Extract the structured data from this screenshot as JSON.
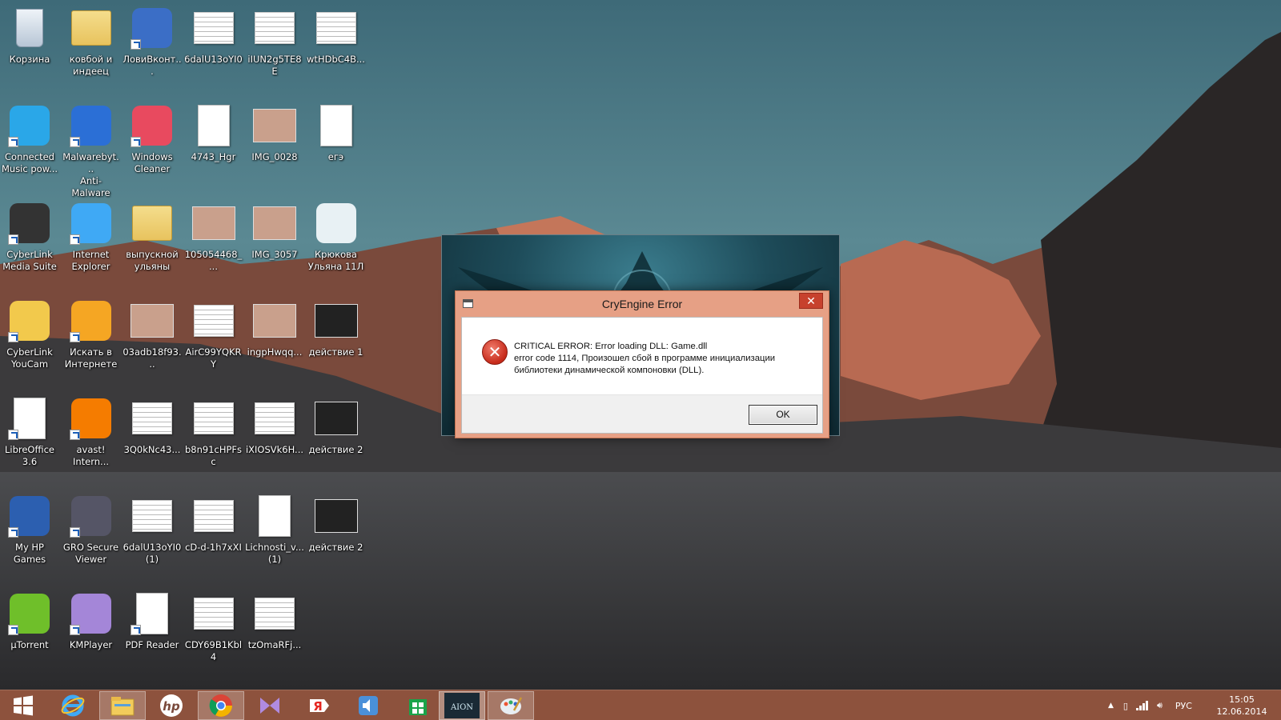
{
  "desktop": {
    "icons": [
      {
        "id": "recycle",
        "label": "Корзина",
        "icon": "recycle-bin-icon"
      },
      {
        "id": "folder1",
        "label": "ковбой и\nиндеец",
        "icon": "folder-icon"
      },
      {
        "id": "lovivk",
        "label": "ЛовиВконт...",
        "icon": "app-lb-icon"
      },
      {
        "id": "doc1",
        "label": "6dalU13oYI0",
        "icon": "document-icon"
      },
      {
        "id": "doc2",
        "label": "iIUN2g5TE8E",
        "icon": "document-icon"
      },
      {
        "id": "doc3",
        "label": "wtHDbC4B...",
        "icon": "document-icon"
      },
      {
        "id": "cmp",
        "label": "Connected\nMusic pow...",
        "icon": "equalizer-icon"
      },
      {
        "id": "mbam",
        "label": "Malwarebyt...\nAnti-Malware",
        "icon": "malwarebytes-icon"
      },
      {
        "id": "wcleaner",
        "label": "Windows\nCleaner",
        "icon": "windows-cleaner-icon"
      },
      {
        "id": "hgr",
        "label": "4743_Hgr",
        "icon": "text-document-icon"
      },
      {
        "id": "img28",
        "label": "IMG_0028",
        "icon": "photo-icon"
      },
      {
        "id": "ege",
        "label": "егэ",
        "icon": "word-document-icon"
      },
      {
        "id": "cyberms",
        "label": "CyberLink\nMedia Suite",
        "icon": "cyberlink-media-suite-icon"
      },
      {
        "id": "ie",
        "label": "Internet\nExplorer",
        "icon": "internet-explorer-icon"
      },
      {
        "id": "folder2",
        "label": "выпускной\nульяны",
        "icon": "folder-icon"
      },
      {
        "id": "img105",
        "label": "105054468_...",
        "icon": "photo-icon"
      },
      {
        "id": "img3057",
        "label": "IMG_3057",
        "icon": "photo-icon"
      },
      {
        "id": "pres",
        "label": "Крюкова\nУльяна 11Л",
        "icon": "presentation-icon"
      },
      {
        "id": "youcam",
        "label": "CyberLink\nYouCam",
        "icon": "youcam-icon"
      },
      {
        "id": "search",
        "label": "Искать в\nИнтернете",
        "icon": "search-web-icon"
      },
      {
        "id": "img03",
        "label": "03adb18f93...",
        "icon": "photo-icon"
      },
      {
        "id": "air",
        "label": "AirC99YQKRY",
        "icon": "document-icon"
      },
      {
        "id": "ingp",
        "label": "ingpHwqq...",
        "icon": "photo-icon"
      },
      {
        "id": "act1",
        "label": "действие 1",
        "icon": "video-icon"
      },
      {
        "id": "libre",
        "label": "LibreOffice\n3.6",
        "icon": "libreoffice-icon"
      },
      {
        "id": "avast",
        "label": "avast!\nIntern...",
        "icon": "avast-icon"
      },
      {
        "id": "doc3q",
        "label": "3Q0kNc43...",
        "icon": "document-icon"
      },
      {
        "id": "doc_b8",
        "label": "b8n91cHPFsc",
        "icon": "document-icon"
      },
      {
        "id": "doc_ix",
        "label": "iXIOSVk6H...",
        "icon": "document-icon"
      },
      {
        "id": "act2a",
        "label": "действие 2",
        "icon": "video-icon"
      },
      {
        "id": "hpgames",
        "label": "My HP\nGames",
        "icon": "hp-games-icon"
      },
      {
        "id": "gro",
        "label": "GRO Secure\nViewer",
        "icon": "secure-viewer-icon"
      },
      {
        "id": "doc6d1",
        "label": "6dalU13oYI0\n(1)",
        "icon": "document-icon"
      },
      {
        "id": "cd",
        "label": "cD-d-1h7xXI",
        "icon": "document-icon"
      },
      {
        "id": "lich",
        "label": "Lichnosti_v...\n(1)",
        "icon": "image-document-icon"
      },
      {
        "id": "act2b",
        "label": "действие 2",
        "icon": "video-icon"
      },
      {
        "id": "utorrent",
        "label": "µTorrent",
        "icon": "utorrent-icon"
      },
      {
        "id": "kmp",
        "label": "KMPlayer",
        "icon": "kmplayer-icon"
      },
      {
        "id": "pdf",
        "label": "PDF Reader",
        "icon": "pdf-reader-icon"
      },
      {
        "id": "cdy",
        "label": "CDY69B1Kbl4",
        "icon": "document-icon"
      },
      {
        "id": "tzo",
        "label": "tzOmaRFj...",
        "icon": "document-icon"
      }
    ]
  },
  "dialog": {
    "title": "CryEngine Error",
    "close_label": "✕",
    "message_line1": "CRITICAL ERROR: Error loading DLL: Game.dll",
    "message_line2": "error code 1114, Произошел сбой в программе инициализации",
    "message_line3": "библиотеки динамической компоновки (DLL).",
    "ok_label": "OK"
  },
  "taskbar": {
    "items": [
      "start-button",
      "internet-explorer-icon",
      "file-explorer-icon",
      "hp-icon",
      "chrome-icon",
      "kmplayer-icon",
      "yandex-icon",
      "audio-app-icon",
      "store-icon",
      "aion-icon",
      "paint-icon"
    ],
    "language": "РУС",
    "time": "15:05",
    "date": "12.06.2014"
  },
  "colors": {
    "taskbar": "#96563e",
    "dialog_frame": "#e6a085",
    "close_button": "#c7412d"
  }
}
